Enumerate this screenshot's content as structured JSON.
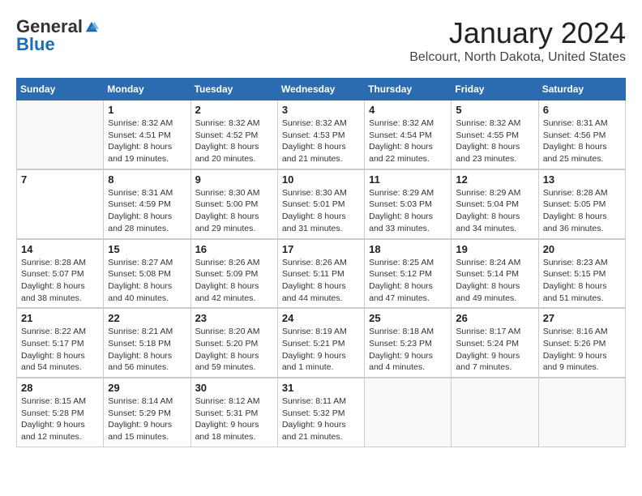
{
  "header": {
    "logo": {
      "general": "General",
      "blue": "Blue"
    },
    "title": "January 2024",
    "location": "Belcourt, North Dakota, United States"
  },
  "weekdays": [
    "Sunday",
    "Monday",
    "Tuesday",
    "Wednesday",
    "Thursday",
    "Friday",
    "Saturday"
  ],
  "weeks": [
    [
      {
        "day": "",
        "info": ""
      },
      {
        "day": "1",
        "info": "Sunrise: 8:32 AM\nSunset: 4:51 PM\nDaylight: 8 hours\nand 19 minutes."
      },
      {
        "day": "2",
        "info": "Sunrise: 8:32 AM\nSunset: 4:52 PM\nDaylight: 8 hours\nand 20 minutes."
      },
      {
        "day": "3",
        "info": "Sunrise: 8:32 AM\nSunset: 4:53 PM\nDaylight: 8 hours\nand 21 minutes."
      },
      {
        "day": "4",
        "info": "Sunrise: 8:32 AM\nSunset: 4:54 PM\nDaylight: 8 hours\nand 22 minutes."
      },
      {
        "day": "5",
        "info": "Sunrise: 8:32 AM\nSunset: 4:55 PM\nDaylight: 8 hours\nand 23 minutes."
      },
      {
        "day": "6",
        "info": "Sunrise: 8:31 AM\nSunset: 4:56 PM\nDaylight: 8 hours\nand 25 minutes."
      }
    ],
    [
      {
        "day": "7",
        "info": ""
      },
      {
        "day": "8",
        "info": "Sunrise: 8:31 AM\nSunset: 4:59 PM\nDaylight: 8 hours\nand 28 minutes."
      },
      {
        "day": "9",
        "info": "Sunrise: 8:30 AM\nSunset: 5:00 PM\nDaylight: 8 hours\nand 29 minutes."
      },
      {
        "day": "10",
        "info": "Sunrise: 8:30 AM\nSunset: 5:01 PM\nDaylight: 8 hours\nand 31 minutes."
      },
      {
        "day": "11",
        "info": "Sunrise: 8:29 AM\nSunset: 5:03 PM\nDaylight: 8 hours\nand 33 minutes."
      },
      {
        "day": "12",
        "info": "Sunrise: 8:29 AM\nSunset: 5:04 PM\nDaylight: 8 hours\nand 34 minutes."
      },
      {
        "day": "13",
        "info": "Sunrise: 8:28 AM\nSunset: 5:05 PM\nDaylight: 8 hours\nand 36 minutes."
      }
    ],
    [
      {
        "day": "14",
        "info": "Sunrise: 8:28 AM\nSunset: 5:07 PM\nDaylight: 8 hours\nand 38 minutes."
      },
      {
        "day": "15",
        "info": "Sunrise: 8:27 AM\nSunset: 5:08 PM\nDaylight: 8 hours\nand 40 minutes."
      },
      {
        "day": "16",
        "info": "Sunrise: 8:26 AM\nSunset: 5:09 PM\nDaylight: 8 hours\nand 42 minutes."
      },
      {
        "day": "17",
        "info": "Sunrise: 8:26 AM\nSunset: 5:11 PM\nDaylight: 8 hours\nand 44 minutes."
      },
      {
        "day": "18",
        "info": "Sunrise: 8:25 AM\nSunset: 5:12 PM\nDaylight: 8 hours\nand 47 minutes."
      },
      {
        "day": "19",
        "info": "Sunrise: 8:24 AM\nSunset: 5:14 PM\nDaylight: 8 hours\nand 49 minutes."
      },
      {
        "day": "20",
        "info": "Sunrise: 8:23 AM\nSunset: 5:15 PM\nDaylight: 8 hours\nand 51 minutes."
      }
    ],
    [
      {
        "day": "21",
        "info": "Sunrise: 8:22 AM\nSunset: 5:17 PM\nDaylight: 8 hours\nand 54 minutes."
      },
      {
        "day": "22",
        "info": "Sunrise: 8:21 AM\nSunset: 5:18 PM\nDaylight: 8 hours\nand 56 minutes."
      },
      {
        "day": "23",
        "info": "Sunrise: 8:20 AM\nSunset: 5:20 PM\nDaylight: 8 hours\nand 59 minutes."
      },
      {
        "day": "24",
        "info": "Sunrise: 8:19 AM\nSunset: 5:21 PM\nDaylight: 9 hours\nand 1 minute."
      },
      {
        "day": "25",
        "info": "Sunrise: 8:18 AM\nSunset: 5:23 PM\nDaylight: 9 hours\nand 4 minutes."
      },
      {
        "day": "26",
        "info": "Sunrise: 8:17 AM\nSunset: 5:24 PM\nDaylight: 9 hours\nand 7 minutes."
      },
      {
        "day": "27",
        "info": "Sunrise: 8:16 AM\nSunset: 5:26 PM\nDaylight: 9 hours\nand 9 minutes."
      }
    ],
    [
      {
        "day": "28",
        "info": "Sunrise: 8:15 AM\nSunset: 5:28 PM\nDaylight: 9 hours\nand 12 minutes."
      },
      {
        "day": "29",
        "info": "Sunrise: 8:14 AM\nSunset: 5:29 PM\nDaylight: 9 hours\nand 15 minutes."
      },
      {
        "day": "30",
        "info": "Sunrise: 8:12 AM\nSunset: 5:31 PM\nDaylight: 9 hours\nand 18 minutes."
      },
      {
        "day": "31",
        "info": "Sunrise: 8:11 AM\nSunset: 5:32 PM\nDaylight: 9 hours\nand 21 minutes."
      },
      {
        "day": "",
        "info": ""
      },
      {
        "day": "",
        "info": ""
      },
      {
        "day": "",
        "info": ""
      }
    ]
  ]
}
